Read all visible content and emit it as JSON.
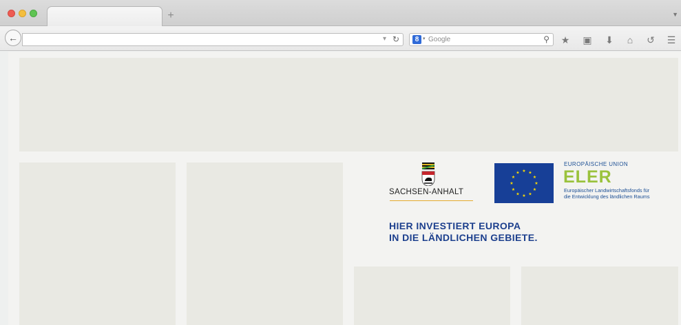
{
  "browser": {
    "new_tab_symbol": "+",
    "tab_list_symbol": "▼",
    "back_symbol": "←",
    "search": {
      "engine_letter": "8",
      "placeholder": "Google"
    }
  },
  "page": {
    "sachsen_anhalt": {
      "name": "SACHSEN-ANHALT"
    },
    "eu": {
      "label": "EUROPÄISCHE UNION",
      "fund_acronym": "ELER",
      "fund_description_line1": "Europäischer Landwirtschaftsfonds für",
      "fund_description_line2": "die Entwicklung des ländlichen Raums"
    },
    "headline": {
      "line1": "HIER INVESTIERT EUROPA",
      "line2": "IN DIE LÄNDLICHEN GEBIETE."
    }
  },
  "colors": {
    "eu_flag_blue": "#173f97",
    "eu_star_yellow": "#ffde00",
    "eler_green": "#9ac23c",
    "headline_blue": "#1c3f8d",
    "placeholder_block": "#e9e9e3"
  },
  "icons": [
    "back-arrow-icon",
    "reload-icon",
    "search-engine-icon",
    "search-icon",
    "bookmark-star-icon",
    "reading-list-icon",
    "download-icon",
    "home-icon",
    "sync-icon",
    "menu-icon"
  ]
}
